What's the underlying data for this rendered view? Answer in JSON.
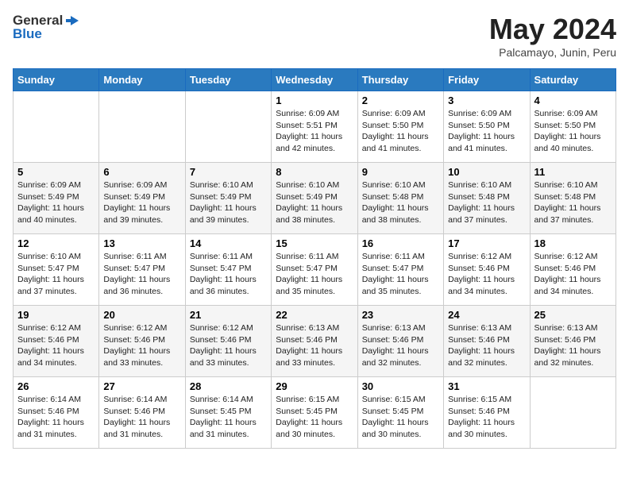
{
  "header": {
    "logo_general": "General",
    "logo_blue": "Blue",
    "month_year": "May 2024",
    "location": "Palcamayo, Junin, Peru"
  },
  "days_of_week": [
    "Sunday",
    "Monday",
    "Tuesday",
    "Wednesday",
    "Thursday",
    "Friday",
    "Saturday"
  ],
  "weeks": [
    [
      {
        "day": "",
        "info": ""
      },
      {
        "day": "",
        "info": ""
      },
      {
        "day": "",
        "info": ""
      },
      {
        "day": "1",
        "info": "Sunrise: 6:09 AM\nSunset: 5:51 PM\nDaylight: 11 hours\nand 42 minutes."
      },
      {
        "day": "2",
        "info": "Sunrise: 6:09 AM\nSunset: 5:50 PM\nDaylight: 11 hours\nand 41 minutes."
      },
      {
        "day": "3",
        "info": "Sunrise: 6:09 AM\nSunset: 5:50 PM\nDaylight: 11 hours\nand 41 minutes."
      },
      {
        "day": "4",
        "info": "Sunrise: 6:09 AM\nSunset: 5:50 PM\nDaylight: 11 hours\nand 40 minutes."
      }
    ],
    [
      {
        "day": "5",
        "info": "Sunrise: 6:09 AM\nSunset: 5:49 PM\nDaylight: 11 hours\nand 40 minutes."
      },
      {
        "day": "6",
        "info": "Sunrise: 6:09 AM\nSunset: 5:49 PM\nDaylight: 11 hours\nand 39 minutes."
      },
      {
        "day": "7",
        "info": "Sunrise: 6:10 AM\nSunset: 5:49 PM\nDaylight: 11 hours\nand 39 minutes."
      },
      {
        "day": "8",
        "info": "Sunrise: 6:10 AM\nSunset: 5:49 PM\nDaylight: 11 hours\nand 38 minutes."
      },
      {
        "day": "9",
        "info": "Sunrise: 6:10 AM\nSunset: 5:48 PM\nDaylight: 11 hours\nand 38 minutes."
      },
      {
        "day": "10",
        "info": "Sunrise: 6:10 AM\nSunset: 5:48 PM\nDaylight: 11 hours\nand 37 minutes."
      },
      {
        "day": "11",
        "info": "Sunrise: 6:10 AM\nSunset: 5:48 PM\nDaylight: 11 hours\nand 37 minutes."
      }
    ],
    [
      {
        "day": "12",
        "info": "Sunrise: 6:10 AM\nSunset: 5:47 PM\nDaylight: 11 hours\nand 37 minutes."
      },
      {
        "day": "13",
        "info": "Sunrise: 6:11 AM\nSunset: 5:47 PM\nDaylight: 11 hours\nand 36 minutes."
      },
      {
        "day": "14",
        "info": "Sunrise: 6:11 AM\nSunset: 5:47 PM\nDaylight: 11 hours\nand 36 minutes."
      },
      {
        "day": "15",
        "info": "Sunrise: 6:11 AM\nSunset: 5:47 PM\nDaylight: 11 hours\nand 35 minutes."
      },
      {
        "day": "16",
        "info": "Sunrise: 6:11 AM\nSunset: 5:47 PM\nDaylight: 11 hours\nand 35 minutes."
      },
      {
        "day": "17",
        "info": "Sunrise: 6:12 AM\nSunset: 5:46 PM\nDaylight: 11 hours\nand 34 minutes."
      },
      {
        "day": "18",
        "info": "Sunrise: 6:12 AM\nSunset: 5:46 PM\nDaylight: 11 hours\nand 34 minutes."
      }
    ],
    [
      {
        "day": "19",
        "info": "Sunrise: 6:12 AM\nSunset: 5:46 PM\nDaylight: 11 hours\nand 34 minutes."
      },
      {
        "day": "20",
        "info": "Sunrise: 6:12 AM\nSunset: 5:46 PM\nDaylight: 11 hours\nand 33 minutes."
      },
      {
        "day": "21",
        "info": "Sunrise: 6:12 AM\nSunset: 5:46 PM\nDaylight: 11 hours\nand 33 minutes."
      },
      {
        "day": "22",
        "info": "Sunrise: 6:13 AM\nSunset: 5:46 PM\nDaylight: 11 hours\nand 33 minutes."
      },
      {
        "day": "23",
        "info": "Sunrise: 6:13 AM\nSunset: 5:46 PM\nDaylight: 11 hours\nand 32 minutes."
      },
      {
        "day": "24",
        "info": "Sunrise: 6:13 AM\nSunset: 5:46 PM\nDaylight: 11 hours\nand 32 minutes."
      },
      {
        "day": "25",
        "info": "Sunrise: 6:13 AM\nSunset: 5:46 PM\nDaylight: 11 hours\nand 32 minutes."
      }
    ],
    [
      {
        "day": "26",
        "info": "Sunrise: 6:14 AM\nSunset: 5:46 PM\nDaylight: 11 hours\nand 31 minutes."
      },
      {
        "day": "27",
        "info": "Sunrise: 6:14 AM\nSunset: 5:46 PM\nDaylight: 11 hours\nand 31 minutes."
      },
      {
        "day": "28",
        "info": "Sunrise: 6:14 AM\nSunset: 5:45 PM\nDaylight: 11 hours\nand 31 minutes."
      },
      {
        "day": "29",
        "info": "Sunrise: 6:15 AM\nSunset: 5:45 PM\nDaylight: 11 hours\nand 30 minutes."
      },
      {
        "day": "30",
        "info": "Sunrise: 6:15 AM\nSunset: 5:45 PM\nDaylight: 11 hours\nand 30 minutes."
      },
      {
        "day": "31",
        "info": "Sunrise: 6:15 AM\nSunset: 5:46 PM\nDaylight: 11 hours\nand 30 minutes."
      },
      {
        "day": "",
        "info": ""
      }
    ]
  ]
}
